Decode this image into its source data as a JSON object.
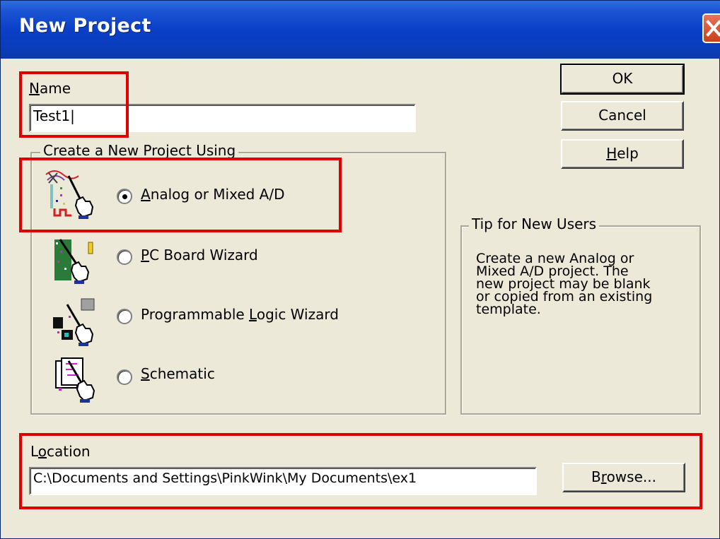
{
  "window": {
    "title": "New Project"
  },
  "name_field": {
    "label_prefix": "",
    "label_underline": "N",
    "label_rest": "ame",
    "value": "Test1|"
  },
  "buttons": {
    "ok": "OK",
    "cancel": "Cancel",
    "help_underline": "H",
    "help_rest": "elp"
  },
  "project_group": {
    "legend": "Create a New Project Using",
    "options": [
      {
        "underline": "A",
        "rest": "nalog or Mixed A/D",
        "selected": true,
        "icon": "analog-wand-icon"
      },
      {
        "underline": "P",
        "rest": "C Board Wizard",
        "selected": false,
        "icon": "pcb-wand-icon"
      },
      {
        "prefix": "Programmable ",
        "underline": "L",
        "rest": "ogic Wizard",
        "selected": false,
        "icon": "logic-wand-icon"
      },
      {
        "underline": "S",
        "rest": "chematic",
        "selected": false,
        "icon": "schematic-wand-icon"
      }
    ]
  },
  "tip": {
    "legend": "Tip for New Users",
    "lines": [
      "Create a new Analog or",
      "Mixed A/D project.  The",
      "new project may be blank",
      "or copied from an existing",
      "template."
    ]
  },
  "location": {
    "label_prefix": "L",
    "label_underline": "o",
    "label_rest": "cation",
    "value": "C:\\Documents and Settings\\PinkWink\\My Documents\\ex1",
    "browse_prefix": "B",
    "browse_underline": "r",
    "browse_rest": "owse..."
  },
  "colors": {
    "titlebar": "#0a3cb9",
    "face": "#ece9d8",
    "highlight_box": "#e00000"
  }
}
